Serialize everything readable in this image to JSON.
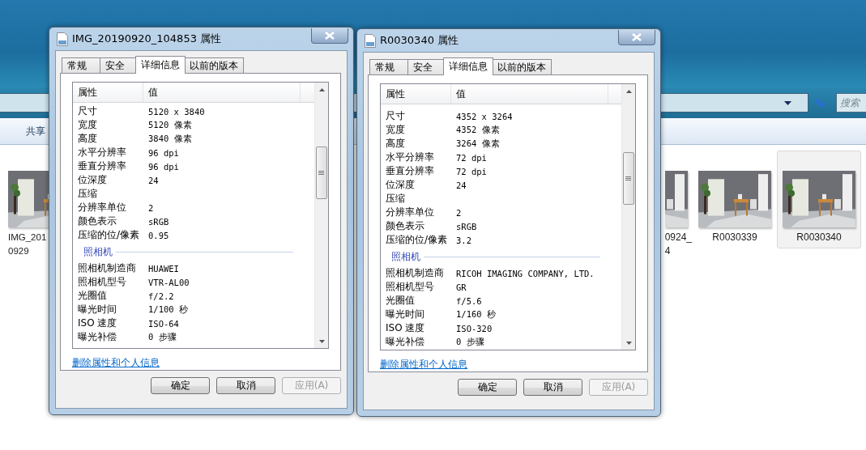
{
  "explorer": {
    "search": {
      "placeholder": "搜索"
    },
    "toolbar": [
      "共享"
    ],
    "files": [
      {
        "kind": "cut",
        "label": [
          "IMG_201",
          "0929"
        ],
        "selected": false
      },
      {
        "kind": "cut",
        "label": [
          "0924_",
          "4"
        ],
        "selected": false
      },
      {
        "kind": "full",
        "label": [
          "R0030339"
        ],
        "selected": false
      },
      {
        "kind": "full",
        "label": [
          "R0030340"
        ],
        "selected": true
      }
    ]
  },
  "dialogs": [
    {
      "title": "IMG_20190920_104853 属性",
      "tabs": [
        {
          "label": "常规",
          "selected": false
        },
        {
          "label": "安全",
          "selected": false
        },
        {
          "label": "详细信息",
          "selected": true
        },
        {
          "label": "以前的版本",
          "selected": false
        }
      ],
      "list": {
        "columns": [
          "属性",
          "值"
        ],
        "rows": [
          {
            "kind": "property",
            "name": "尺寸",
            "value": "5120 x 3840"
          },
          {
            "kind": "property",
            "name": "宽度",
            "value": "5120 像素"
          },
          {
            "kind": "property",
            "name": "高度",
            "value": "3840 像素"
          },
          {
            "kind": "property",
            "name": "水平分辨率",
            "value": "96 dpi"
          },
          {
            "kind": "property",
            "name": "垂直分辨率",
            "value": "96 dpi"
          },
          {
            "kind": "property",
            "name": "位深度",
            "value": "24"
          },
          {
            "kind": "property",
            "name": "压缩"
          },
          {
            "kind": "property",
            "name": "分辨率单位",
            "value": "2"
          },
          {
            "kind": "property",
            "name": "颜色表示",
            "value": "sRGB"
          },
          {
            "kind": "property",
            "name": "压缩的位/像素",
            "value": "0.95"
          },
          {
            "kind": "group",
            "name": "照相机"
          },
          {
            "kind": "property",
            "name": "照相机制造商",
            "value": "HUAWEI"
          },
          {
            "kind": "property",
            "name": "照相机型号",
            "value": "VTR-AL00"
          },
          {
            "kind": "property",
            "name": "光圈值",
            "value": "f/2.2"
          },
          {
            "kind": "property",
            "name": "曝光时间",
            "value": "1/100 秒"
          },
          {
            "kind": "property",
            "name": "ISO 速度",
            "value": "ISO-64"
          },
          {
            "kind": "property",
            "name": "曝光补偿",
            "value": "0 步骤"
          }
        ]
      },
      "link": "删除属性和个人信息",
      "buttons": [
        {
          "label": "确定",
          "disabled": false
        },
        {
          "label": "取消",
          "disabled": false
        },
        {
          "label": "应用(A)",
          "disabled": true
        }
      ]
    },
    {
      "title": "R0030340 属性",
      "tabs": [
        {
          "label": "常规",
          "selected": false
        },
        {
          "label": "安全",
          "selected": false
        },
        {
          "label": "详细信息",
          "selected": true
        },
        {
          "label": "以前的版本",
          "selected": false
        }
      ],
      "list": {
        "columns": [
          "属性",
          "值"
        ],
        "rows": [
          {
            "kind": "property",
            "name": "尺寸",
            "value": "4352 x 3264"
          },
          {
            "kind": "property",
            "name": "宽度",
            "value": "4352 像素"
          },
          {
            "kind": "property",
            "name": "高度",
            "value": "3264 像素"
          },
          {
            "kind": "property",
            "name": "水平分辨率",
            "value": "72 dpi"
          },
          {
            "kind": "property",
            "name": "垂直分辨率",
            "value": "72 dpi"
          },
          {
            "kind": "property",
            "name": "位深度",
            "value": "24"
          },
          {
            "kind": "property",
            "name": "压缩"
          },
          {
            "kind": "property",
            "name": "分辨率单位",
            "value": "2"
          },
          {
            "kind": "property",
            "name": "颜色表示",
            "value": "sRGB"
          },
          {
            "kind": "property",
            "name": "压缩的位/像素",
            "value": "3.2"
          },
          {
            "kind": "group",
            "name": "照相机"
          },
          {
            "kind": "property",
            "name": "照相机制造商",
            "value": "RICOH IMAGING COMPANY, LTD."
          },
          {
            "kind": "property",
            "name": "照相机型号",
            "value": "GR"
          },
          {
            "kind": "property",
            "name": "光圈值",
            "value": "f/5.6"
          },
          {
            "kind": "property",
            "name": "曝光时间",
            "value": "1/160 秒"
          },
          {
            "kind": "property",
            "name": "ISO 速度",
            "value": "ISO-320"
          },
          {
            "kind": "property",
            "name": "曝光补偿",
            "value": "0 步骤"
          }
        ]
      },
      "link": "删除属性和个人信息",
      "buttons": [
        {
          "label": "确定",
          "disabled": false
        },
        {
          "label": "取消",
          "disabled": false
        },
        {
          "label": "应用(A)",
          "disabled": true
        }
      ]
    }
  ]
}
